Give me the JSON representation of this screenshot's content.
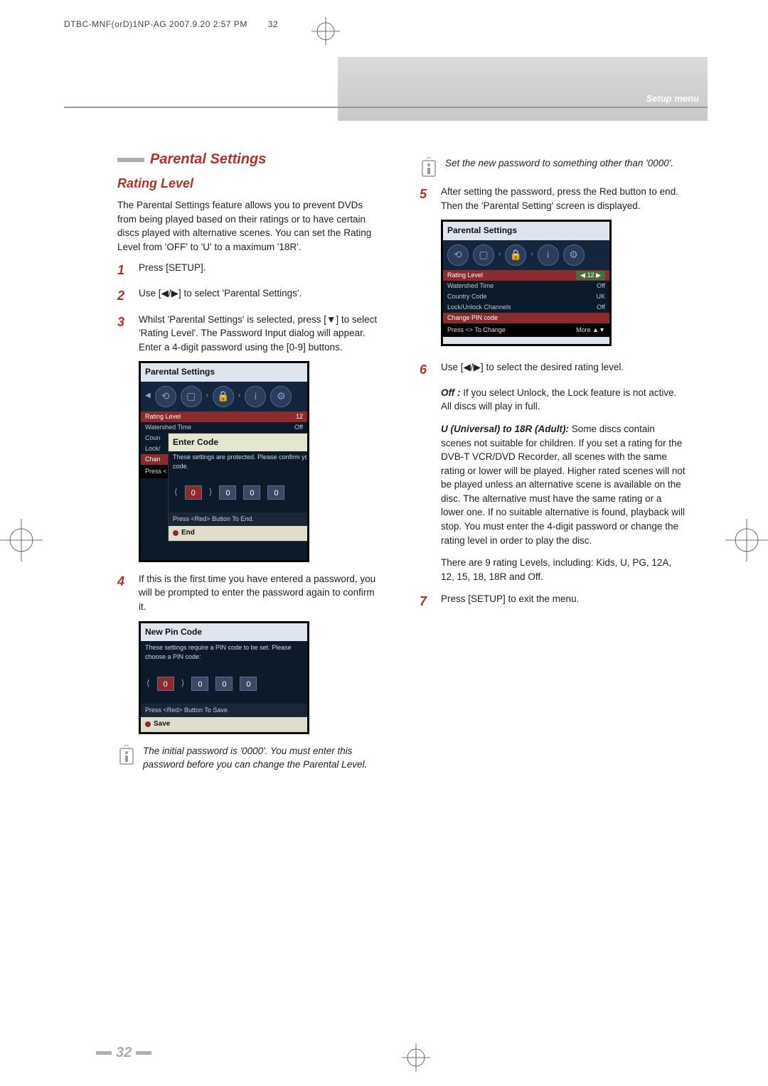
{
  "header": {
    "doc_stamp": "DTBC-MNF(orD)1NP-AG 2007.9.20 2:57 PM",
    "stamp_page": "32",
    "section_label": "Setup menu"
  },
  "left": {
    "heading": "Parental Settings",
    "subheading": "Rating Level",
    "intro": "The Parental Settings feature allows you to prevent DVDs from being played based on their ratings or to have certain discs played with alternative scenes. You can set the Rating Level from 'OFF' to 'U' to a maximum '18R'.",
    "step1": "Press [SETUP].",
    "step2": "Use [◀/▶] to select 'Parental Settings'.",
    "step3": "Whilst 'Parental Settings' is selected, press [▼] to select 'Rating Level'. The Password Input dialog will appear. Enter a 4-digit password using the [0-9] buttons.",
    "step4": "If this is the first time you have entered a password, you will be prompted to enter the password again to confirm it.",
    "note1": "The initial password is '0000'. You must enter this password before you can change the Parental Level."
  },
  "right": {
    "note2": "Set the new password to something other than '0000'.",
    "step5": "After setting the password, press the Red button to end. Then the 'Parental Setting' screen is displayed.",
    "step6": "Use [◀/▶] to select the desired rating level.",
    "off_label": "Off :",
    "off_body": "If you select Unlock, the Lock feature is not active. All discs will play in full.",
    "u18r_label": "U (Universal) to 18R (Adult):",
    "u18r_body": "Some discs contain scenes not suitable for children. If you set a rating for the DVB-T VCR/DVD Recorder, all scenes with the same rating or lower will be played. Higher rated scenes will not be played unless an alternative scene is available on the disc. The alternative must have the same rating or a lower one. If no suitable alternative is found, playback will stop. You must enter the 4-digit password or change the rating level in order to play the disc.",
    "rating_list": "There are 9 rating Levels, including: Kids, U, PG, 12A, 12, 15, 18, 18R and Off.",
    "step7": "Press [SETUP] to exit the menu."
  },
  "ss": {
    "parental": {
      "title": "Parental Settings",
      "rows": [
        {
          "label": "Rating Level",
          "value": "12"
        },
        {
          "label": "Watershed Time",
          "value": "Off"
        },
        {
          "label": "Country Code",
          "value": "UK"
        },
        {
          "label": "Lock/Unlock Channels",
          "value": "Off"
        },
        {
          "label": "Change PIN code",
          "value": ""
        }
      ],
      "more_left": "Press <> To Change",
      "more_right": "More ▲▼"
    },
    "enter_code": {
      "title": "Enter Code",
      "msg": "These settings are protected. Please confirm your PIN code.",
      "foot": "Press <Red> Button To End.",
      "end": "End"
    },
    "new_pin": {
      "title": "New Pin Code",
      "msg": "These settings require a PIN code to be set. Please choose a PIN code:",
      "foot": "Press <Red> Button To Save.",
      "end": "Save"
    }
  },
  "page_number": "32"
}
